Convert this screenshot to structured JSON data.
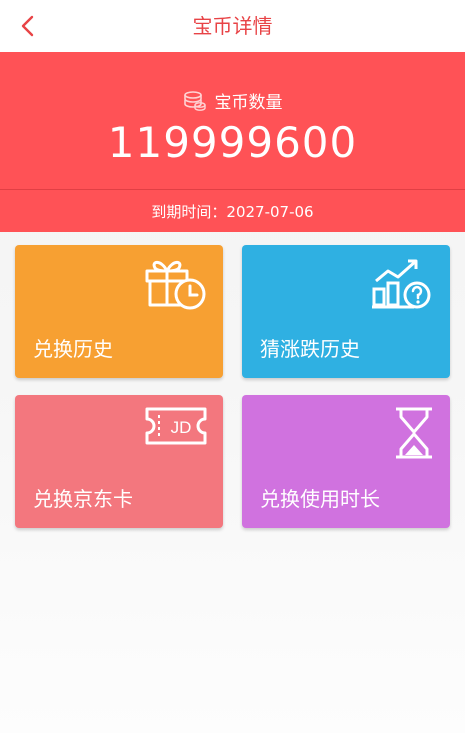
{
  "header": {
    "title": "宝币详情",
    "back_icon": "chevron-left-icon"
  },
  "balance": {
    "icon": "coin-stack-icon",
    "label": "宝币数量",
    "amount": "119999600",
    "expiry": "到期时间：2027-07-06"
  },
  "cards": [
    {
      "label": "兑换历史",
      "icon": "gift-clock-icon",
      "color": "#f7a032"
    },
    {
      "label": "猜涨跌历史",
      "icon": "trend-chart-question-icon",
      "color": "#2fb0e2"
    },
    {
      "label": "兑换京东卡",
      "icon": "jd-ticket-icon",
      "color": "#f3777e"
    },
    {
      "label": "兑换使用时长",
      "icon": "hourglass-icon",
      "color": "#d072df"
    }
  ],
  "colors": {
    "accent": "#e84346",
    "hero_background": "#ff5256"
  }
}
